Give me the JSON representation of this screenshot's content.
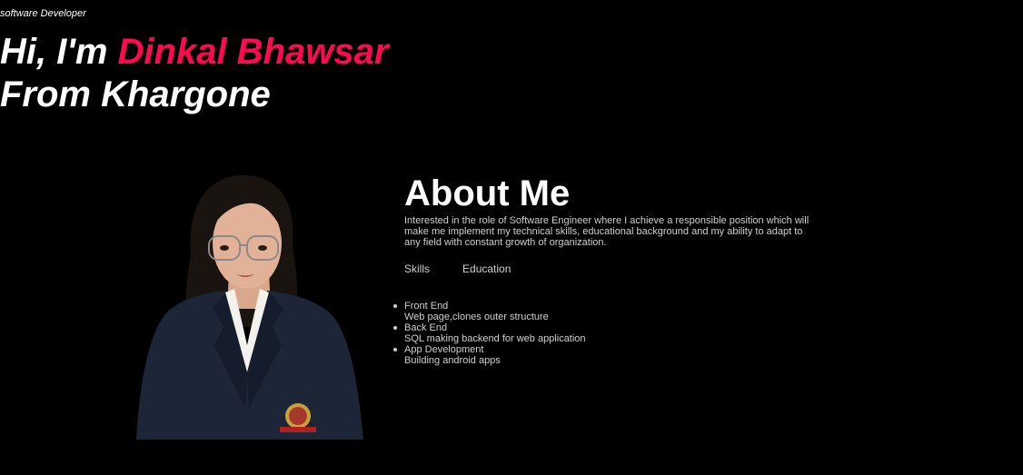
{
  "hero": {
    "role": "software Developer",
    "greeting": "Hi, I'm ",
    "name": "Dinkal Bhawsar",
    "location_line": "From Khargone"
  },
  "about": {
    "heading": "About Me",
    "description": "Interested in the role of Software Engineer where I achieve a responsible position which will make me implement my technical skills, educational background and my ability to adapt to any field with constant growth of organization.",
    "tabs": [
      {
        "label": "Skills"
      },
      {
        "label": "Education"
      }
    ],
    "skills": [
      {
        "title": "Front End",
        "description": "Web page,clones outer structure"
      },
      {
        "title": "Back End",
        "description": "SQL making backend for web application"
      },
      {
        "title": "App Development",
        "description": "Building android apps"
      }
    ]
  },
  "colors": {
    "background": "#000000",
    "accent": "#ff0a4e",
    "text": "#ffffff",
    "muted": "#cfcfcf"
  },
  "icons": {
    "profile_photo": "profile-photo"
  }
}
